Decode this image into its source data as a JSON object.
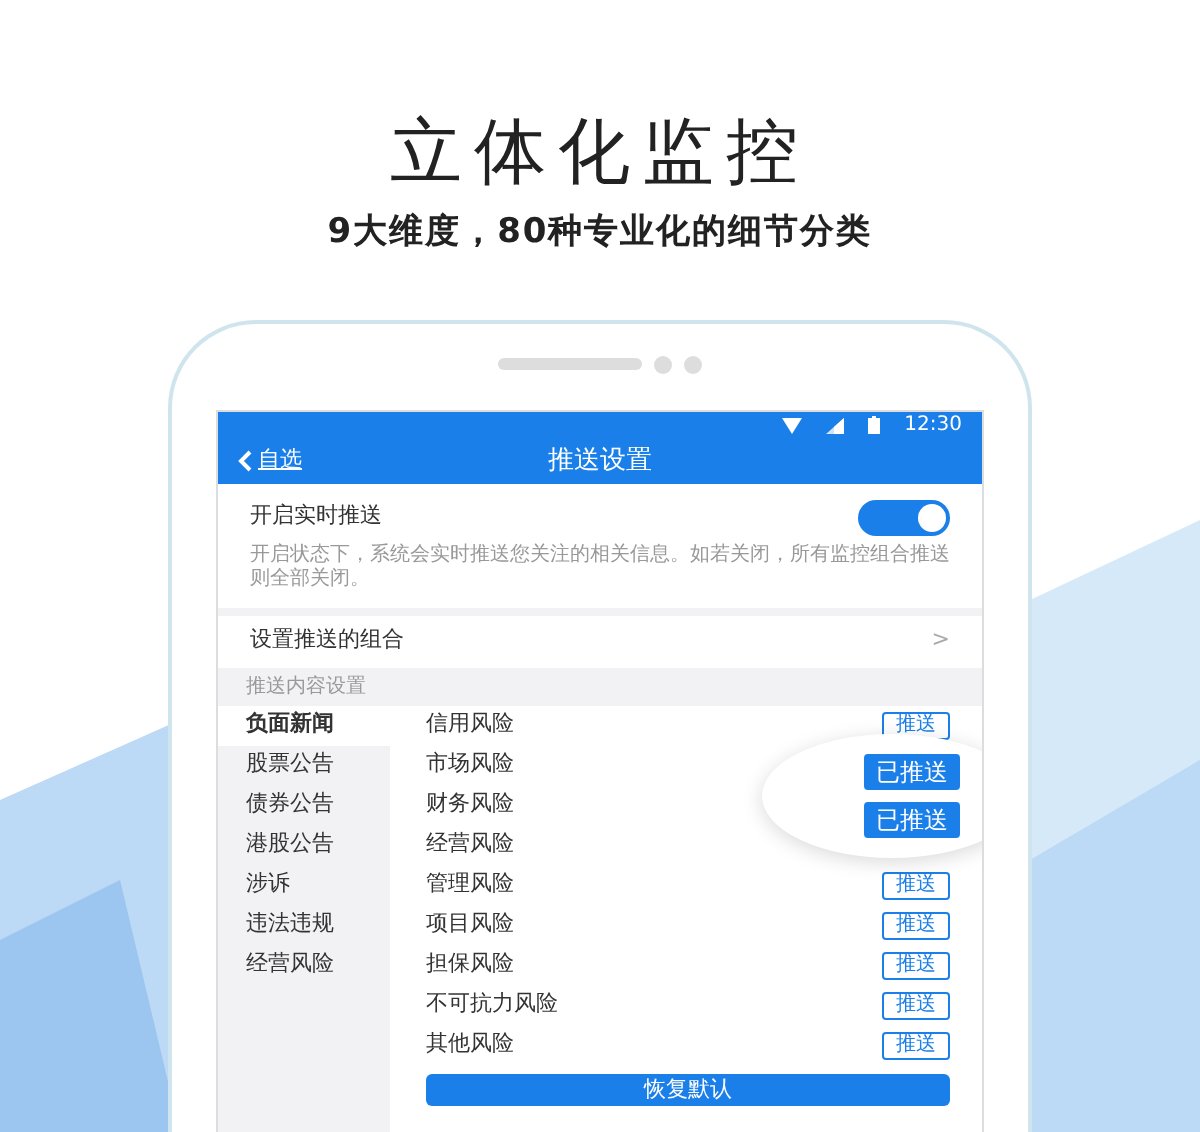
{
  "headline": "立体化监控",
  "subheadline": "9大维度，80种专业化的细节分类",
  "status_bar": {
    "time": "12:30"
  },
  "nav": {
    "back": "自选",
    "title": "推送设置"
  },
  "realtime_push": {
    "label": "开启实时推送",
    "on": true,
    "description": "开启状态下，系统会实时推送您关注的相关信息。如若关闭，所有监控组合推送则全部关闭。"
  },
  "combo_row": {
    "label": "设置推送的组合",
    "chevron": ">"
  },
  "section_label": "推送内容设置",
  "categories": [
    {
      "label": "负面新闻",
      "selected": true
    },
    {
      "label": "股票公告",
      "selected": false
    },
    {
      "label": "债券公告",
      "selected": false
    },
    {
      "label": "港股公告",
      "selected": false
    },
    {
      "label": "涉诉",
      "selected": false
    },
    {
      "label": "违法违规",
      "selected": false
    },
    {
      "label": "经营风险",
      "selected": false
    }
  ],
  "items": [
    {
      "label": "信用风险",
      "button": {
        "label": "推送",
        "pushed": false
      }
    },
    {
      "label": "市场风险"
    },
    {
      "label": "财务风险"
    },
    {
      "label": "经营风险"
    },
    {
      "label": "管理风险",
      "button": {
        "label": "推送",
        "pushed": false
      }
    },
    {
      "label": "项目风险",
      "button": {
        "label": "推送",
        "pushed": false
      }
    },
    {
      "label": "担保风险",
      "button": {
        "label": "推送",
        "pushed": false
      }
    },
    {
      "label": "不可抗力风险",
      "button": {
        "label": "推送",
        "pushed": false
      }
    },
    {
      "label": "其他风险",
      "button": {
        "label": "推送",
        "pushed": false
      }
    }
  ],
  "magnifier": [
    {
      "label": "已推送",
      "pushed": true
    },
    {
      "label": "已推送",
      "pushed": true
    }
  ],
  "reset_button": "恢复默认"
}
